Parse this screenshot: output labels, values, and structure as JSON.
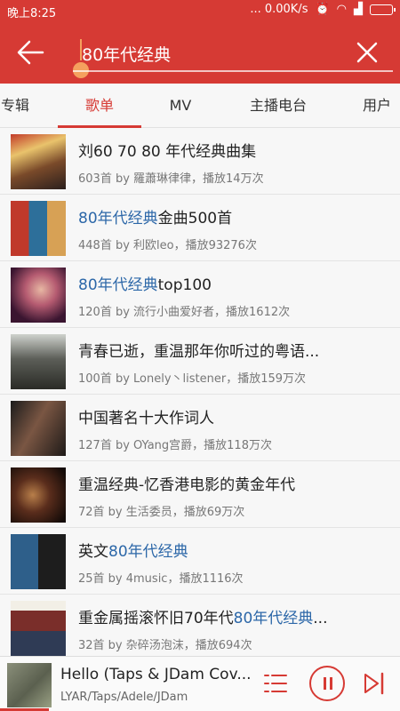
{
  "status": {
    "time": "晚上8:25",
    "network": "... 0.00K/s"
  },
  "search": {
    "query": "80年代经典"
  },
  "tabs": [
    "专辑",
    "歌单",
    "MV",
    "主播电台",
    "用户"
  ],
  "active_tab": "歌单",
  "playlists": [
    {
      "title_pre": "刘60 70 80 年代经典曲集",
      "title_hl": "",
      "title_post": "",
      "meta": "603首  by 羅蕭琳律律，播放14万次"
    },
    {
      "title_pre": "",
      "title_hl": "80年代经典",
      "title_post": "金曲500首",
      "meta": "448首  by 利欧leo，播放93276次"
    },
    {
      "title_pre": "",
      "title_hl": "80年代经典",
      "title_post": "top100",
      "meta": "120首  by 流行小曲爱好者，播放1612次"
    },
    {
      "title_pre": "青春已逝，重温那年你听过的粤语...",
      "title_hl": "",
      "title_post": "",
      "meta": "100首  by Lonely丶listener，播放159万次"
    },
    {
      "title_pre": "中国著名十大作词人",
      "title_hl": "",
      "title_post": "",
      "meta": "127首  by OYang宫爵，播放118万次"
    },
    {
      "title_pre": "重温经典-忆香港电影的黄金年代",
      "title_hl": "",
      "title_post": "",
      "meta": "72首  by 生活委员，播放69万次"
    },
    {
      "title_pre": "英文",
      "title_hl": "80年代经典",
      "title_post": "",
      "meta": "25首  by 4music，播放1116次"
    },
    {
      "title_pre": "重金属摇滚怀旧70年代",
      "title_hl": "80年代经典",
      "title_post": "...",
      "meta": "32首  by 杂碎汤泡沫，播放694次"
    }
  ],
  "player": {
    "title": "Hello (Taps & JDam Cov...",
    "artist": "LYAR/Taps/Adele/JDam"
  },
  "colors": {
    "brand": "#d63a34",
    "highlight": "#2c67a8",
    "cursor": "#f5a05e"
  },
  "icons": [
    "back-arrow-icon",
    "close-icon",
    "playlist-icon",
    "pause-icon",
    "next-icon"
  ]
}
